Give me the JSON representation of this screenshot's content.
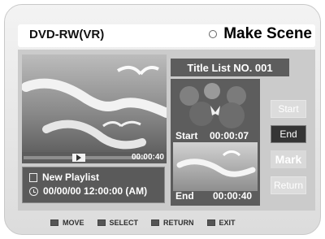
{
  "header": {
    "device_label": "DVD-RW(VR)",
    "mode_title": "Make Scene",
    "mode_icon": "circle-icon"
  },
  "player": {
    "time": "00:00:40",
    "play_icon": "play-icon"
  },
  "info": {
    "playlist_label": "New Playlist",
    "datetime": "00/00/00 12:00:00 (AM)",
    "playlist_icon": "document-icon",
    "datetime_icon": "clock-icon"
  },
  "title_list": {
    "heading": "Title List NO. 001",
    "start_label": "Start",
    "start_time": "00:00:07",
    "end_label": "End",
    "end_time": "00:00:40"
  },
  "buttons": {
    "start": "Start",
    "end": "End",
    "mark": "Mark",
    "return": "Return"
  },
  "footer": {
    "move": "MOVE",
    "select": "SELECT",
    "return": "RETURN",
    "exit": "EXIT",
    "move_icon": "updown-arrows-icon",
    "select_icon": "enter-icon",
    "return_icon": "return-arrow-icon",
    "exit_icon": "menu-icon"
  },
  "colors": {
    "panel": "#cbcbcb",
    "dark": "#5c5c5c",
    "selected": "#353535",
    "inactive": "#dcdcdc"
  }
}
